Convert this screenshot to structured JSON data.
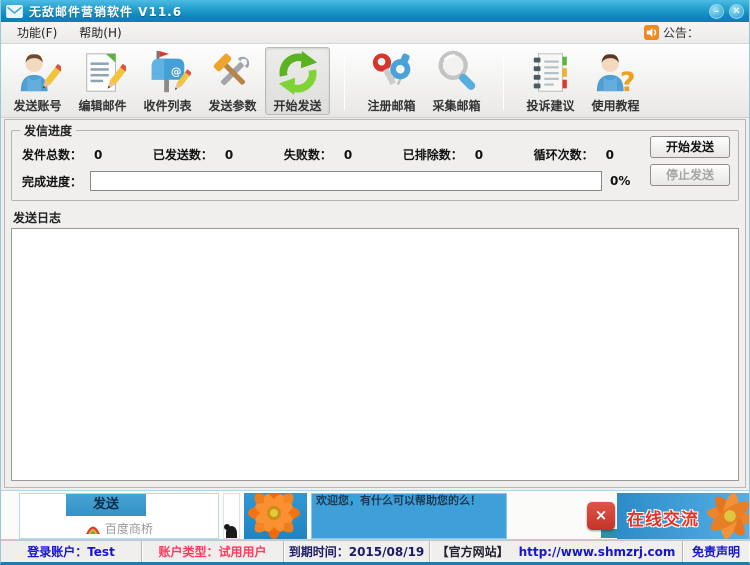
{
  "window": {
    "title": "无敌邮件营销软件   V11.6",
    "minimize_glyph": "–",
    "close_glyph": "✕"
  },
  "menubar": {
    "items": [
      {
        "label": "功能(F)"
      },
      {
        "label": "帮助(H)"
      }
    ],
    "announcement_label": "公告："
  },
  "toolbar": {
    "items": [
      {
        "label": "发送账号"
      },
      {
        "label": "编辑邮件"
      },
      {
        "label": "收件列表"
      },
      {
        "label": "发送参数"
      },
      {
        "label": "开始发送",
        "selected": true
      },
      {
        "label": "注册邮箱"
      },
      {
        "label": "采集邮箱"
      },
      {
        "label": "投诉建议"
      },
      {
        "label": "使用教程"
      }
    ]
  },
  "progress": {
    "group_title": "发信进度",
    "stats": [
      {
        "label": "发件总数：",
        "value": "0"
      },
      {
        "label": "已发送数：",
        "value": "0"
      },
      {
        "label": "失败数：",
        "value": "0"
      },
      {
        "label": "已排除数：",
        "value": "0"
      },
      {
        "label": "循环次数：",
        "value": "0"
      }
    ],
    "progress_label": "完成进度：",
    "percent": "0%",
    "start_button": "开始发送",
    "stop_button": "停止发送"
  },
  "log": {
    "title": "发送日志",
    "content": ""
  },
  "banner": {
    "send_button": "发送",
    "baidu_bridge": "百度商桥",
    "welcome_text": "欢迎您，有什么可以帮助您的么！",
    "online_chat": "在线交流",
    "close_glyph": "×"
  },
  "statusbar": {
    "login_label": "登录账户：",
    "login_value": "Test",
    "account_type_label": "账户类型：",
    "account_type_value": "试用用户",
    "expiry_label": "到期时间：",
    "expiry_value": "2015/08/19",
    "website_label": "【官方网站】",
    "website_url": "http://www.shmzrj.com",
    "disclaimer": "免责声明"
  },
  "colors": {
    "titlebar_top": "#4dbce4",
    "titlebar_bottom": "#0d7fb2",
    "accent_green": "#6cc02c",
    "status_red": "#ff3b60",
    "status_blue": "#1515d0",
    "banner_blue": "#3f9fd9",
    "online_chat_red": "#e63126",
    "close_red": "#c43428"
  }
}
